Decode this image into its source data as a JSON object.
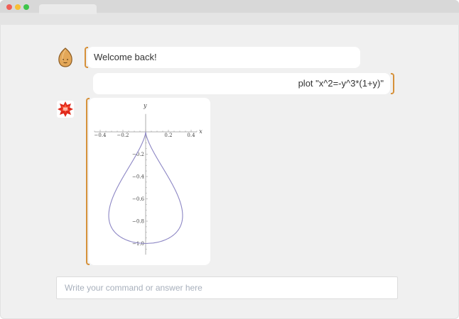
{
  "colors": {
    "window_bg": "#f0f0f0",
    "bracket": "#d6913a",
    "curve": "#8c86c4",
    "input_placeholder": "#a8b0bc"
  },
  "icons": {
    "user_avatar": "almond-avatar-icon",
    "bot_avatar": "wolfram-star-icon"
  },
  "chat": {
    "messages": [
      {
        "from": "bot",
        "text": "Welcome back!"
      },
      {
        "from": "user",
        "text": "plot \"x^2=-y^3*(1+y)\""
      }
    ]
  },
  "plot": {
    "x_axis_label": "x",
    "y_axis_label": "y",
    "x_ticks": [
      "−0.4",
      "−0.2",
      "0.2",
      "0.4"
    ],
    "y_ticks": [
      "−0.2",
      "−0.4",
      "−0.6",
      "−0.8",
      "−1.0"
    ]
  },
  "chart_data": {
    "type": "line",
    "equation": "x^2=-y^3*(1+y)",
    "xlabel": "x",
    "ylabel": "y",
    "xlim": [
      -0.45,
      0.45
    ],
    "ylim": [
      -1.05,
      0.1
    ],
    "x_ticks": [
      -0.4,
      -0.2,
      0.2,
      0.4
    ],
    "y_ticks": [
      -0.2,
      -0.4,
      -0.6,
      -0.8,
      -1.0
    ],
    "series": [
      {
        "points": [
          [
            0,
            0
          ],
          [
            0.12,
            -0.3
          ],
          [
            0.25,
            -0.55
          ],
          [
            0.32,
            -0.75
          ],
          [
            0.28,
            -0.9
          ],
          [
            0.15,
            -0.97
          ],
          [
            0,
            -1.0
          ],
          [
            -0.15,
            -0.97
          ],
          [
            -0.28,
            -0.9
          ],
          [
            -0.32,
            -0.75
          ],
          [
            -0.25,
            -0.55
          ],
          [
            -0.12,
            -0.3
          ],
          [
            0,
            0
          ]
        ]
      }
    ]
  },
  "input": {
    "placeholder": "Write your command or answer here",
    "value": ""
  }
}
